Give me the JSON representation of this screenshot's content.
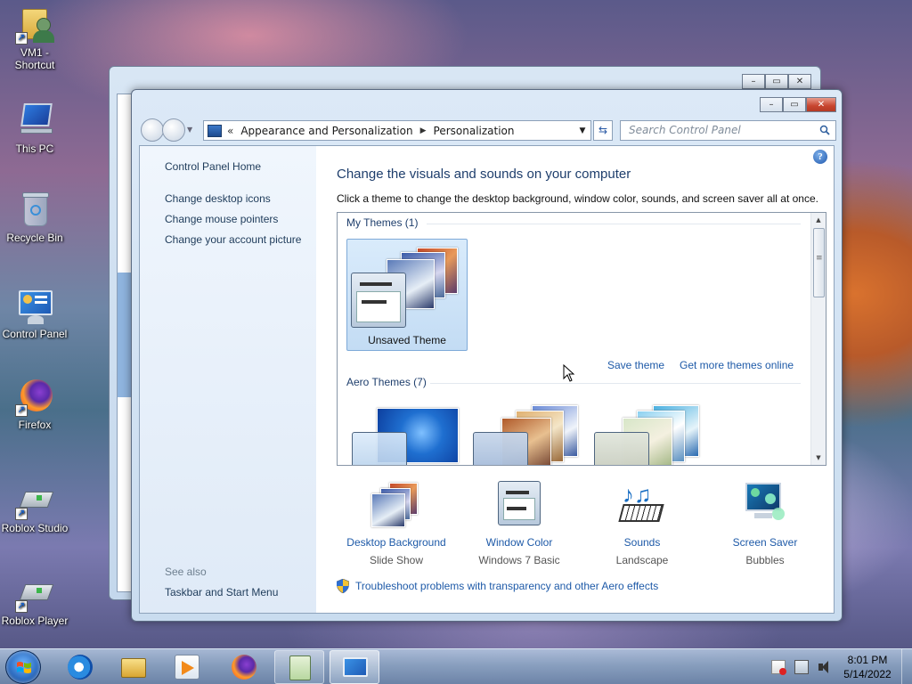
{
  "desktop": {
    "icons": [
      {
        "label": "VM1 - Shortcut",
        "icon": "folder-user-shortcut-icon"
      },
      {
        "label": "This PC",
        "icon": "computer-icon"
      },
      {
        "label": "Recycle Bin",
        "icon": "recycle-bin-icon"
      },
      {
        "label": "Control Panel",
        "icon": "control-panel-icon"
      },
      {
        "label": "Firefox",
        "icon": "firefox-icon"
      },
      {
        "label": "Roblox Studio",
        "icon": "roblox-studio-icon"
      },
      {
        "label": "Roblox Player",
        "icon": "roblox-player-icon"
      }
    ]
  },
  "window": {
    "title_buttons": {
      "minimize": "–",
      "maximize": "▭",
      "close": "✕"
    },
    "address": {
      "chevron": "«",
      "crumbs": [
        "Appearance and Personalization",
        "Personalization"
      ],
      "separator": "▶",
      "dropdown": "▼"
    },
    "refresh_glyph": "⇆",
    "search_placeholder": "Search Control Panel"
  },
  "sidebar": {
    "home": "Control Panel Home",
    "links": [
      "Change desktop icons",
      "Change mouse pointers",
      "Change your account picture"
    ],
    "see_also_label": "See also",
    "see_also_links": [
      "Taskbar and Start Menu"
    ]
  },
  "main": {
    "help_glyph": "?",
    "heading": "Change the visuals and sounds on your computer",
    "subheading": "Click a theme to change the desktop background, window color, sounds, and screen saver all at once.",
    "my_themes_title": "My Themes (1)",
    "my_themes": [
      {
        "label": "Unsaved Theme",
        "selected": true
      }
    ],
    "save_theme": "Save theme",
    "get_more": "Get more themes online",
    "aero_title": "Aero Themes (7)",
    "bottom": [
      {
        "title": "Desktop Background",
        "value": "Slide Show",
        "icon": "desktop-background-icon"
      },
      {
        "title": "Window Color",
        "value": "Windows 7 Basic",
        "icon": "window-color-icon"
      },
      {
        "title": "Sounds",
        "value": "Landscape",
        "icon": "sounds-icon"
      },
      {
        "title": "Screen Saver",
        "value": "Bubbles",
        "icon": "screen-saver-icon"
      }
    ],
    "troubleshoot": "Troubleshoot problems with transparency and other Aero effects"
  },
  "taskbar": {
    "time": "8:01 PM",
    "date": "5/14/2022",
    "pinned": [
      "internet-explorer-icon",
      "file-explorer-icon",
      "media-player-icon",
      "firefox-icon",
      "notepad-icon",
      "control-panel-icon"
    ]
  },
  "colors": {
    "link": "#1e5aa8",
    "heading": "#1e3e6c",
    "selection": "#c3dcf4"
  }
}
